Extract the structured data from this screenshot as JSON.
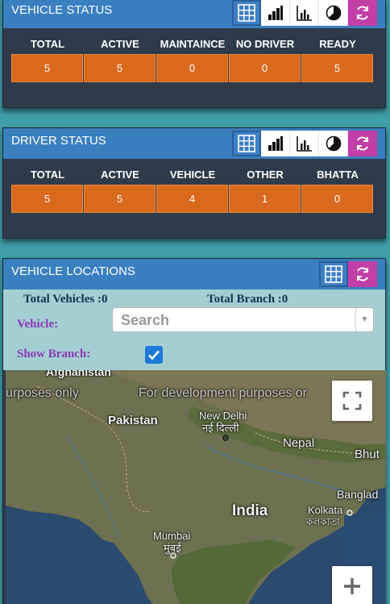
{
  "vehicle_status": {
    "title": "VEHICLE STATUS",
    "headers": [
      "TOTAL",
      "ACTIVE",
      "MAINTAINCE",
      "NO DRIVER",
      "READY"
    ],
    "values": [
      "5",
      "5",
      "0",
      "0",
      "5"
    ]
  },
  "driver_status": {
    "title": "DRIVER STATUS",
    "headers": [
      "TOTAL",
      "ACTIVE",
      "VEHICLE",
      "OTHER",
      "BHATTA"
    ],
    "values": [
      "5",
      "5",
      "4",
      "1",
      "0"
    ]
  },
  "vehicle_locations": {
    "title": "VEHICLE LOCATIONS",
    "total_vehicles": "Total Vehicles :0",
    "total_branch": "Total Branch :0",
    "vehicle_label": "Vehicle:",
    "search_placeholder": "Search",
    "show_branch_label": "Show Branch:",
    "show_branch_checked": true
  },
  "map": {
    "watermark_left": "urposes only",
    "watermark_right": "For development purposes or",
    "labels": {
      "afghanistan": "Afghanistan",
      "pakistan": "Pakistan",
      "new_delhi": "New Delhi",
      "new_delhi_hindi": "नई दिल्ली",
      "nepal": "Nepal",
      "bhutan": "Bhut",
      "india": "India",
      "bangladesh": "Banglad",
      "kolkata": "Kolkata",
      "kolkata_bengali": "কলকাতা",
      "mumbai": "Mumbai",
      "mumbai_marathi": "मुंबई"
    }
  },
  "colors": {
    "page_bg": "#3f9ea7",
    "panel_bg": "#2f3b4a",
    "header_blue": "#3a7fc0",
    "value_orange": "#d9691d",
    "refresh_magenta": "#c23fa7",
    "label_purple": "#8a38b5"
  },
  "icons": [
    "grid-icon",
    "bar-chart-icon",
    "column-chart-icon",
    "pie-chart-icon",
    "refresh-icon",
    "fullscreen-icon",
    "zoom-in-icon"
  ]
}
